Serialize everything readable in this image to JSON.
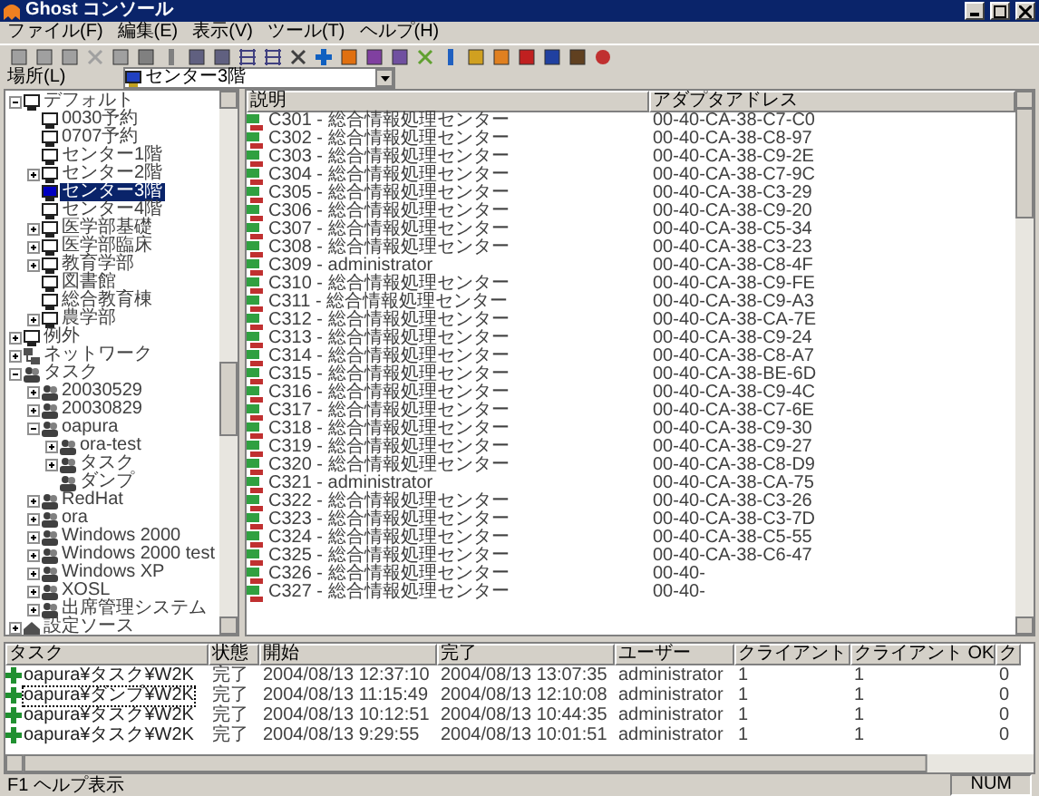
{
  "window": {
    "title": "Ghost コンソール"
  },
  "menu": [
    "ファイル(F)",
    "編集(E)",
    "表示(V)",
    "ツール(T)",
    "ヘルプ(H)"
  ],
  "toolbar": [
    {
      "kind": "square",
      "color": "#a0a0a0"
    },
    {
      "kind": "square",
      "color": "#a0a0a0"
    },
    {
      "kind": "square",
      "color": "#a0a0a0"
    },
    {
      "kind": "cross",
      "color": "#a0a0a0"
    },
    {
      "kind": "square",
      "color": "#a0a0a0"
    },
    {
      "kind": "square",
      "color": "#808080"
    },
    {
      "kind": "bar",
      "color": "#808080"
    },
    {
      "kind": "square",
      "color": "#606080"
    },
    {
      "kind": "square",
      "color": "#606080"
    },
    {
      "kind": "grid",
      "color": "#404080"
    },
    {
      "kind": "grid",
      "color": "#404080"
    },
    {
      "kind": "cross",
      "color": "#404040"
    },
    {
      "kind": "plus",
      "color": "#1060c0"
    },
    {
      "kind": "square",
      "color": "#e07010"
    },
    {
      "kind": "square",
      "color": "#8040a0"
    },
    {
      "kind": "square",
      "color": "#7050a0"
    },
    {
      "kind": "cross",
      "color": "#60a030"
    },
    {
      "kind": "bar",
      "color": "#2060c0"
    },
    {
      "kind": "square",
      "color": "#d0a020"
    },
    {
      "kind": "square",
      "color": "#e08020"
    },
    {
      "kind": "square",
      "color": "#c02020"
    },
    {
      "kind": "square",
      "color": "#2040a0"
    },
    {
      "kind": "square",
      "color": "#604020"
    },
    {
      "kind": "circle",
      "color": "#c03030"
    }
  ],
  "location": {
    "label": "場所(L)",
    "value": "センター3階"
  },
  "tree": [
    {
      "label": "デフォルト",
      "kind": "group",
      "expanded": true,
      "selected": false,
      "children": [
        {
          "label": "0030予約",
          "kind": "group",
          "selected": false
        },
        {
          "label": "0707予約",
          "kind": "group",
          "selected": false
        },
        {
          "label": "センター1階",
          "kind": "group",
          "selected": false
        },
        {
          "label": "センター2階",
          "kind": "group",
          "expanded": false,
          "selected": false
        },
        {
          "label": "センター3階",
          "kind": "group",
          "selected": true
        },
        {
          "label": "センター4階",
          "kind": "group",
          "selected": false
        },
        {
          "label": "医学部基礎",
          "kind": "group",
          "expanded": false,
          "selected": false
        },
        {
          "label": "医学部臨床",
          "kind": "group",
          "expanded": false,
          "selected": false
        },
        {
          "label": "教育学部",
          "kind": "group",
          "expanded": false,
          "selected": false
        },
        {
          "label": "図書館",
          "kind": "group",
          "selected": false
        },
        {
          "label": "総合教育棟",
          "kind": "group",
          "selected": false
        },
        {
          "label": "農学部",
          "kind": "group",
          "expanded": false,
          "selected": false
        }
      ]
    },
    {
      "label": "例外",
      "kind": "group",
      "expanded": false,
      "selected": false
    },
    {
      "label": "ネットワーク",
      "kind": "network",
      "expanded": false,
      "selected": false
    },
    {
      "label": "タスク",
      "kind": "task",
      "expanded": true,
      "selected": false,
      "children": [
        {
          "label": "20030529",
          "kind": "task",
          "expanded": false,
          "selected": false
        },
        {
          "label": "20030829",
          "kind": "task",
          "expanded": false,
          "selected": false
        },
        {
          "label": "oapura",
          "kind": "task",
          "expanded": true,
          "selected": false,
          "children": [
            {
              "label": "ora-test",
              "kind": "task",
              "expanded": false,
              "selected": false
            },
            {
              "label": "タスク",
              "kind": "task",
              "expanded": false,
              "selected": false
            },
            {
              "label": "ダンプ",
              "kind": "task",
              "selected": false
            }
          ]
        },
        {
          "label": "RedHat",
          "kind": "task",
          "expanded": false,
          "selected": false
        },
        {
          "label": "ora",
          "kind": "task",
          "expanded": false,
          "selected": false
        },
        {
          "label": "Windows 2000",
          "kind": "task",
          "expanded": false,
          "selected": false
        },
        {
          "label": "Windows 2000 test",
          "kind": "task",
          "expanded": false,
          "selected": false
        },
        {
          "label": "Windows XP",
          "kind": "task",
          "expanded": false,
          "selected": false
        },
        {
          "label": "XOSL",
          "kind": "task",
          "expanded": false,
          "selected": false
        },
        {
          "label": "出席管理システム",
          "kind": "task",
          "expanded": false,
          "selected": false
        }
      ]
    },
    {
      "label": "設定ソース",
      "kind": "config",
      "expanded": false,
      "selected": false
    }
  ],
  "machines": {
    "columns": [
      "説明",
      "アダプタアドレス"
    ],
    "rows": [
      [
        "C301 - 総合情報処理センター",
        "00-40-CA-38-C7-C0"
      ],
      [
        "C302 - 総合情報処理センター",
        "00-40-CA-38-C8-97"
      ],
      [
        "C303 - 総合情報処理センター",
        "00-40-CA-38-C9-2E"
      ],
      [
        "C304 - 総合情報処理センター",
        "00-40-CA-38-C7-9C"
      ],
      [
        "C305 - 総合情報処理センター",
        "00-40-CA-38-C3-29"
      ],
      [
        "C306 - 総合情報処理センター",
        "00-40-CA-38-C9-20"
      ],
      [
        "C307 - 総合情報処理センター",
        "00-40-CA-38-C5-34"
      ],
      [
        "C308 - 総合情報処理センター",
        "00-40-CA-38-C3-23"
      ],
      [
        "C309 - administrator",
        "00-40-CA-38-C8-4F"
      ],
      [
        "C310 - 総合情報処理センター",
        "00-40-CA-38-C9-FE"
      ],
      [
        "C311 - 総合情報処理センター",
        "00-40-CA-38-C9-A3"
      ],
      [
        "C312 - 総合情報処理センター",
        "00-40-CA-38-CA-7E"
      ],
      [
        "C313 - 総合情報処理センター",
        "00-40-CA-38-C9-24"
      ],
      [
        "C314 - 総合情報処理センター",
        "00-40-CA-38-C8-A7"
      ],
      [
        "C315 - 総合情報処理センター",
        "00-40-CA-38-BE-6D"
      ],
      [
        "C316 - 総合情報処理センター",
        "00-40-CA-38-C9-4C"
      ],
      [
        "C317 - 総合情報処理センター",
        "00-40-CA-38-C7-6E"
      ],
      [
        "C318 - 総合情報処理センター",
        "00-40-CA-38-C9-30"
      ],
      [
        "C319 - 総合情報処理センター",
        "00-40-CA-38-C9-27"
      ],
      [
        "C320 - 総合情報処理センター",
        "00-40-CA-38-C8-D9"
      ],
      [
        "C321 - administrator",
        "00-40-CA-38-CA-75"
      ],
      [
        "C322 - 総合情報処理センター",
        "00-40-CA-38-C3-26"
      ],
      [
        "C323 - 総合情報処理センター",
        "00-40-CA-38-C3-7D"
      ],
      [
        "C324 - 総合情報処理センター",
        "00-40-CA-38-C5-55"
      ],
      [
        "C325 - 総合情報処理センター",
        "00-40-CA-38-C6-47"
      ],
      [
        "C326 - 総合情報処理センター",
        "00-40-"
      ],
      [
        "C327 - 総合情報処理センター",
        "00-40-"
      ]
    ]
  },
  "tasks": {
    "columns": [
      "タスク",
      "状態",
      "開始",
      "完了",
      "ユーザー",
      "クライアント",
      "クライアント OK",
      "ク"
    ],
    "rows": [
      {
        "selected": false,
        "cells": [
          "oapura¥タスク¥W2K",
          "完了",
          "2004/08/13 12:37:10",
          "2004/08/13 13:07:35",
          "administrator",
          "1",
          "1",
          "0"
        ]
      },
      {
        "selected": true,
        "cells": [
          "oapura¥ダンプ¥W2K",
          "完了",
          "2004/08/13 11:15:49",
          "2004/08/13 12:10:08",
          "administrator",
          "1",
          "1",
          "0"
        ]
      },
      {
        "selected": false,
        "cells": [
          "oapura¥タスク¥W2K",
          "完了",
          "2004/08/13 10:12:51",
          "2004/08/13 10:44:35",
          "administrator",
          "1",
          "1",
          "0"
        ]
      },
      {
        "selected": false,
        "cells": [
          "oapura¥タスク¥W2K",
          "完了",
          "2004/08/13 9:29:55",
          "2004/08/13 10:01:51",
          "administrator",
          "1",
          "1",
          "0"
        ]
      }
    ]
  },
  "status_bar": {
    "text": "F1 ヘルプ表示",
    "indicator": "NUM"
  }
}
